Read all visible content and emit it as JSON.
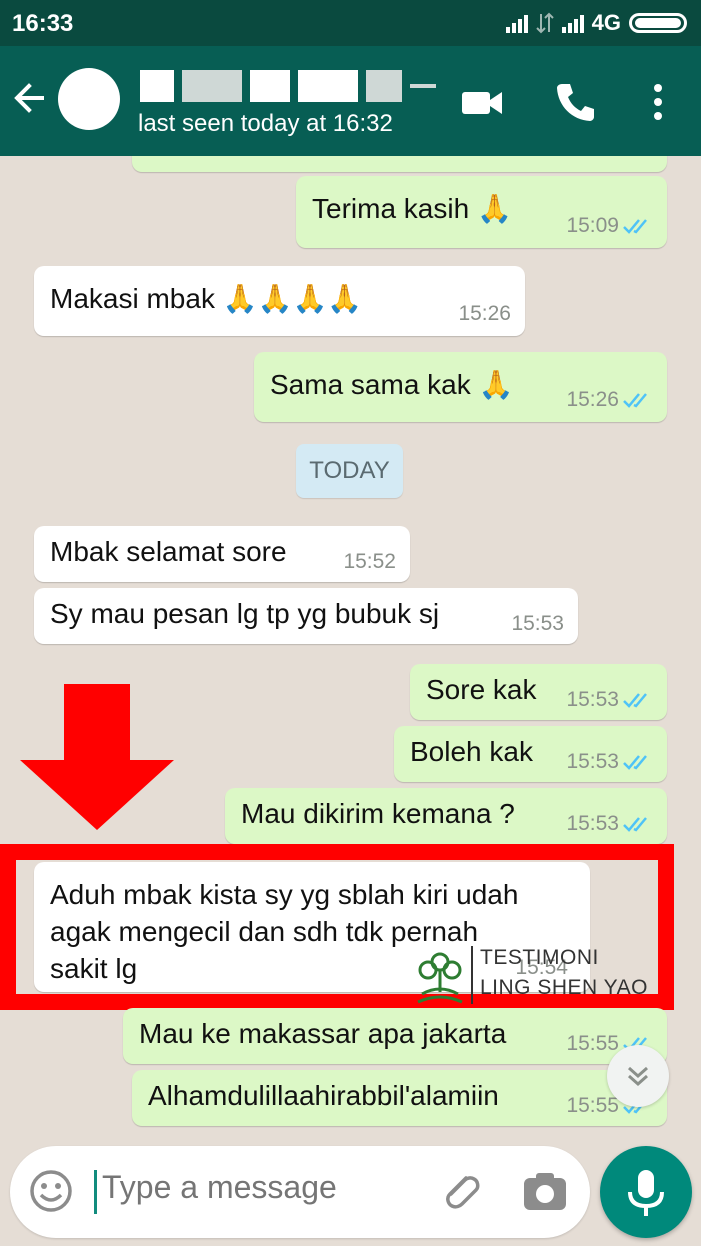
{
  "status_bar": {
    "time": "16:33",
    "network": "4G"
  },
  "header": {
    "last_seen": "last seen today at 16:32"
  },
  "messages": [
    {
      "text": "Terima kasih 🙏",
      "time": "15:09"
    },
    {
      "text": "Makasi mbak 🙏🙏🙏🙏",
      "time": "15:26"
    },
    {
      "text": "Sama sama kak 🙏",
      "time": "15:26"
    },
    {
      "text": "Mbak selamat sore",
      "time": "15:52"
    },
    {
      "text": "Sy mau pesan lg tp yg bubuk sj",
      "time": "15:53"
    },
    {
      "text": "Sore kak",
      "time": "15:53"
    },
    {
      "text": "Boleh kak",
      "time": "15:53"
    },
    {
      "text": "Mau dikirim kemana ?",
      "time": "15:53"
    },
    {
      "text": "Aduh mbak kista sy yg sblah kiri udah\nagak mengecil dan sdh tdk pernah\nsakit lg",
      "time": "15:54"
    },
    {
      "text": "Mau ke makassar apa jakarta",
      "time": "15:55"
    },
    {
      "text": "Alhamdulillaahirabbil'alamiin",
      "time": "15:55"
    }
  ],
  "day_divider": "TODAY",
  "watermark": {
    "line1": "TESTIMONI",
    "line2": "LING SHEN YAO"
  },
  "input": {
    "placeholder": "Type a message"
  },
  "colors": {
    "header": "#075e54",
    "outgoing": "#dcf8c6",
    "incoming": "#ffffff",
    "highlight": "#ff0000",
    "tick": "#4fc3f7"
  }
}
